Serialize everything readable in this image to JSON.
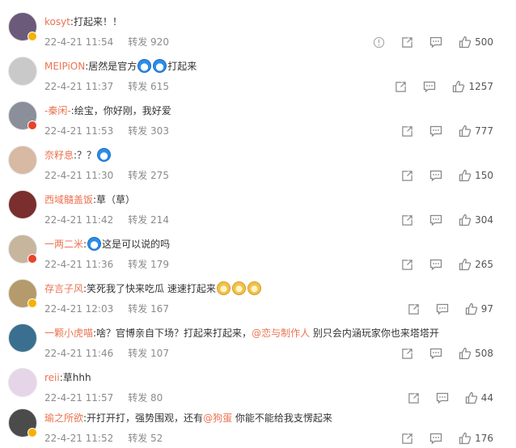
{
  "comments": [
    {
      "user": "kosyt",
      "text": ":打起来！！",
      "date": "22-4-21 11:54",
      "repost": "转发 920",
      "likes": "500",
      "badge": "gold",
      "avatar_color": "#6b5a7a",
      "has_report": true
    },
    {
      "user": "MEIPiON",
      "text_a": ":居然是官方",
      "text_b": "打起来",
      "date": "22-4-21 11:37",
      "repost": "转发 615",
      "likes": "1257",
      "badge": "",
      "avatar_color": "#c9c9c9"
    },
    {
      "user": "-秦闲-",
      "text": ":绘宝，你好刚，我好爱",
      "date": "22-4-21 11:53",
      "repost": "转发 303",
      "likes": "777",
      "badge": "red",
      "avatar_color": "#8a8f9a"
    },
    {
      "user": "奈籽息",
      "text": ":？？",
      "date": "22-4-21 11:30",
      "repost": "转发 275",
      "likes": "150",
      "badge": "",
      "avatar_color": "#d7b9a4"
    },
    {
      "user": "西域髓盖饭",
      "text": ":草（草）",
      "date": "22-4-21 11:42",
      "repost": "转发 214",
      "likes": "304",
      "badge": "",
      "avatar_color": "#7a2e2e"
    },
    {
      "user": "一两二米",
      "text": "这是可以说的吗",
      "date": "22-4-21 11:36",
      "repost": "转发 179",
      "likes": "265",
      "badge": "red",
      "avatar_color": "#c7b59d"
    },
    {
      "user": "存言子风",
      "text": ":笑死我了快来吃瓜 速速打起来",
      "date": "22-4-21 12:03",
      "repost": "转发 167",
      "likes": "97",
      "badge": "gold",
      "avatar_color": "#b59a6b"
    },
    {
      "user": "一颗小虎喵",
      "text_a": ":啥？官博亲自下场？打起来打起来，",
      "mention": "@恋与制作人",
      "text_b": " 别只会内涵玩家你也来塔塔开",
      "date": "22-4-21 11:46",
      "repost": "转发 107",
      "likes": "508",
      "badge": "",
      "avatar_color": "#3a6f8f"
    },
    {
      "user": "reii",
      "text": ":草hhh",
      "date": "22-4-21 11:57",
      "repost": "转发 80",
      "likes": "44",
      "badge": "",
      "avatar_color": "#e6d5e8"
    },
    {
      "user": "瑜之所欲",
      "text_a": ":开打开打，强势围观，还有",
      "mention": "@狗蛋",
      "text_b": " 你能不能给我支愣起来",
      "date": "22-4-21 11:52",
      "repost": "转发 52",
      "likes": "176",
      "badge": "gold",
      "avatar_color": "#4b4b4b"
    }
  ]
}
